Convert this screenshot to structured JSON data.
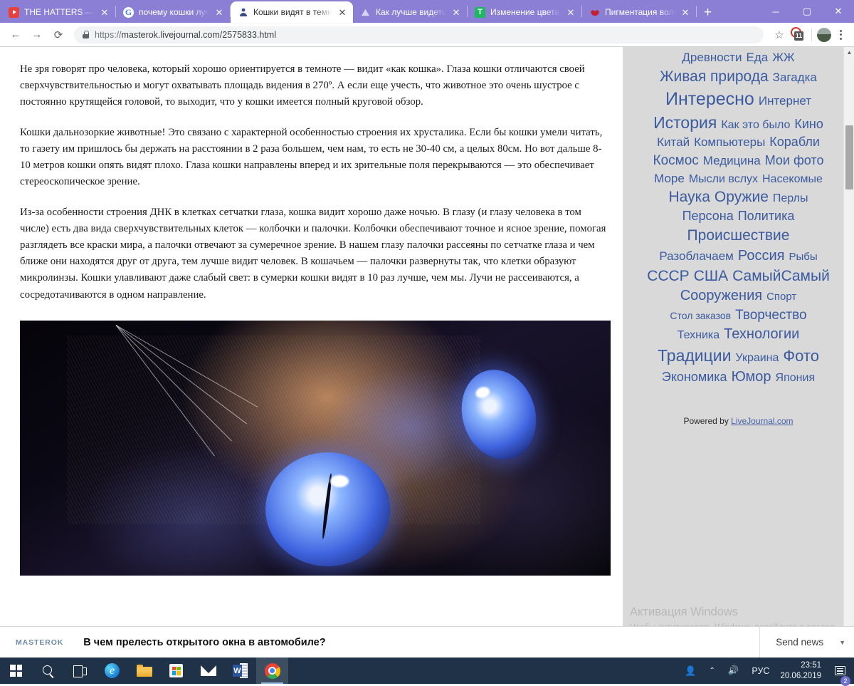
{
  "browser": {
    "tabs": [
      {
        "title": "THE HATTERS — TA",
        "favicon": "youtube-icon",
        "active": false
      },
      {
        "title": "почему кошки луч",
        "favicon": "google-icon",
        "active": false
      },
      {
        "title": "Кошки видят в темн",
        "favicon": "livejournal-icon",
        "active": true
      },
      {
        "title": "Как лучше видеть в",
        "favicon": "mountain-icon",
        "active": false
      },
      {
        "title": "Изменение цвета в",
        "favicon": "tinkoff-icon",
        "active": false
      },
      {
        "title": "Пигментация волос",
        "favicon": "lips-icon",
        "active": false
      }
    ],
    "new_tab_label": "+",
    "tab_close_label": "✕",
    "window_controls": {
      "minimize": "─",
      "maximize": "▢",
      "close": "✕"
    },
    "toolbar": {
      "back_label": "←",
      "forward_label": "→",
      "reload_label": "⟳",
      "url_scheme": "https://",
      "url_rest": "masterok.livejournal.com/2575833.html",
      "star_label": "☆",
      "extension_badge": "11"
    }
  },
  "article": {
    "paragraphs": [
      "Не зря говорят про человека, который хорошо ориентируется в темноте — видит «как кошка». Глаза кошки отличаются своей сверхчувствительностью и могут охватывать площадь видения в 270º. А если еще учесть, что животное это очень шустрое с постоянно крутящейся головой, то выходит, что у кошки имеется полный круговой обзор.",
      "Кошки дальнозоркие животные! Это связано с характерной особенностью строения их хрусталика. Если бы кошки умели читать, то газету им пришлось бы держать на расстоянии в 2 раза большем, чем нам, то есть не 30-40 см, а целых 80см. Но вот дальше 8-10 метров кошки опять видят плохо. Глаза кошки направлены вперед и их зрительные поля перекрываются — это обеспечивает стереоскопическое зрение.",
      "Из-за особенности строения ДНК в клетках сетчатки глаза, кошка видит хорошо даже ночью. В глазу (и глазу человека в том числе) есть два вида сверхчувствительных клеток — колбочки и палочки. Колбочки обеспечивают точное и ясное зрение, помогая разглядеть все краски мира, а палочки отвечают за сумеречное зрение. В нашем глазу палочки рассеяны по сетчатке глаза и чем ближе они находятся друг от друга, тем лучше видит человек. В кошачьем — палочки развернуты так, что клетки образуют микролинзы. Кошки улавливают даже слабый свет: в сумерки кошки видят в 10 раз лучше, чем мы. Лучи не рассеиваются, а сосредотачиваются в одном направление."
    ],
    "photo_alt": "Крупный план морды сиамской кошки с ярко-синими светящимися глазами"
  },
  "sidebar": {
    "tag_rows": [
      [
        {
          "label": "Древности",
          "size": 17
        },
        {
          "label": "Еда",
          "size": 17
        },
        {
          "label": "ЖЖ",
          "size": 17
        }
      ],
      [
        {
          "label": "Живая природа",
          "size": 21
        },
        {
          "label": "Загадка",
          "size": 17
        }
      ],
      [
        {
          "label": "Интересно",
          "size": 25
        },
        {
          "label": "Интернет",
          "size": 17
        }
      ],
      [
        {
          "label": "История",
          "size": 23
        },
        {
          "label": "Как это было",
          "size": 16
        },
        {
          "label": "Кино",
          "size": 18
        }
      ],
      [
        {
          "label": "Китай",
          "size": 17
        },
        {
          "label": "Компьютеры",
          "size": 17
        },
        {
          "label": "Корабли",
          "size": 18
        }
      ],
      [
        {
          "label": "Космос",
          "size": 19
        },
        {
          "label": "Медицина",
          "size": 17
        },
        {
          "label": "Мои фото",
          "size": 18
        }
      ],
      [
        {
          "label": "Море",
          "size": 17
        },
        {
          "label": "Мысли вслух",
          "size": 16
        },
        {
          "label": "Насекомые",
          "size": 16
        }
      ],
      [
        {
          "label": "Наука",
          "size": 21
        },
        {
          "label": "Оружие",
          "size": 21
        },
        {
          "label": "Перлы",
          "size": 16
        }
      ],
      [
        {
          "label": "Персона",
          "size": 18
        },
        {
          "label": "Политика",
          "size": 18
        }
      ],
      [
        {
          "label": "Происшествие",
          "size": 21
        }
      ],
      [
        {
          "label": "Разоблачаем",
          "size": 17
        },
        {
          "label": "Россия",
          "size": 20
        },
        {
          "label": "Рыбы",
          "size": 15
        }
      ],
      [
        {
          "label": "СССР",
          "size": 21
        },
        {
          "label": "США",
          "size": 21
        },
        {
          "label": "СамыйСамый",
          "size": 21
        }
      ],
      [
        {
          "label": "Сооружения",
          "size": 20
        },
        {
          "label": "Спорт",
          "size": 15
        }
      ],
      [
        {
          "label": "Стол заказов",
          "size": 14
        },
        {
          "label": "Творчество",
          "size": 19
        }
      ],
      [
        {
          "label": "Техника",
          "size": 16
        },
        {
          "label": "Технологии",
          "size": 20
        }
      ],
      [
        {
          "label": "Традиции",
          "size": 23
        },
        {
          "label": "Украина",
          "size": 16
        },
        {
          "label": "Фото",
          "size": 22
        }
      ],
      [
        {
          "label": "Экономика",
          "size": 18
        },
        {
          "label": "Юмор",
          "size": 20
        },
        {
          "label": "Япония",
          "size": 16
        }
      ]
    ],
    "powered_prefix": "Powered by ",
    "powered_link": "LiveJournal.com",
    "tag_color": "#3b5a9f"
  },
  "windows_activation": {
    "title": "Активация Windows",
    "subtitle": "Чтобы активировать Windows, перейдите в раздел \"Параметры\"."
  },
  "news_bar": {
    "brand": "MASTEROK",
    "headline": "В чем прелесть открытого окна в автомобиле?",
    "send_label": "Send news",
    "caret": "▼"
  },
  "taskbar": {
    "items": [
      {
        "name": "start-button",
        "label": "Пуск"
      },
      {
        "name": "search-button",
        "label": "Поиск"
      },
      {
        "name": "task-view-button",
        "label": "Представление задач"
      },
      {
        "name": "edge-button",
        "label": "Microsoft Edge"
      },
      {
        "name": "file-explorer-button",
        "label": "Проводник"
      },
      {
        "name": "microsoft-store-button",
        "label": "Microsoft Store"
      },
      {
        "name": "mail-button",
        "label": "Почта"
      },
      {
        "name": "word-button",
        "label": "Word"
      },
      {
        "name": "chrome-button",
        "label": "Google Chrome"
      }
    ],
    "tray": {
      "people_label": "People",
      "chevron_label": "⌃",
      "volume_label": "🔊",
      "language": "РУС",
      "time": "23:51",
      "date": "20.06.2019",
      "notification_count": "2"
    }
  }
}
